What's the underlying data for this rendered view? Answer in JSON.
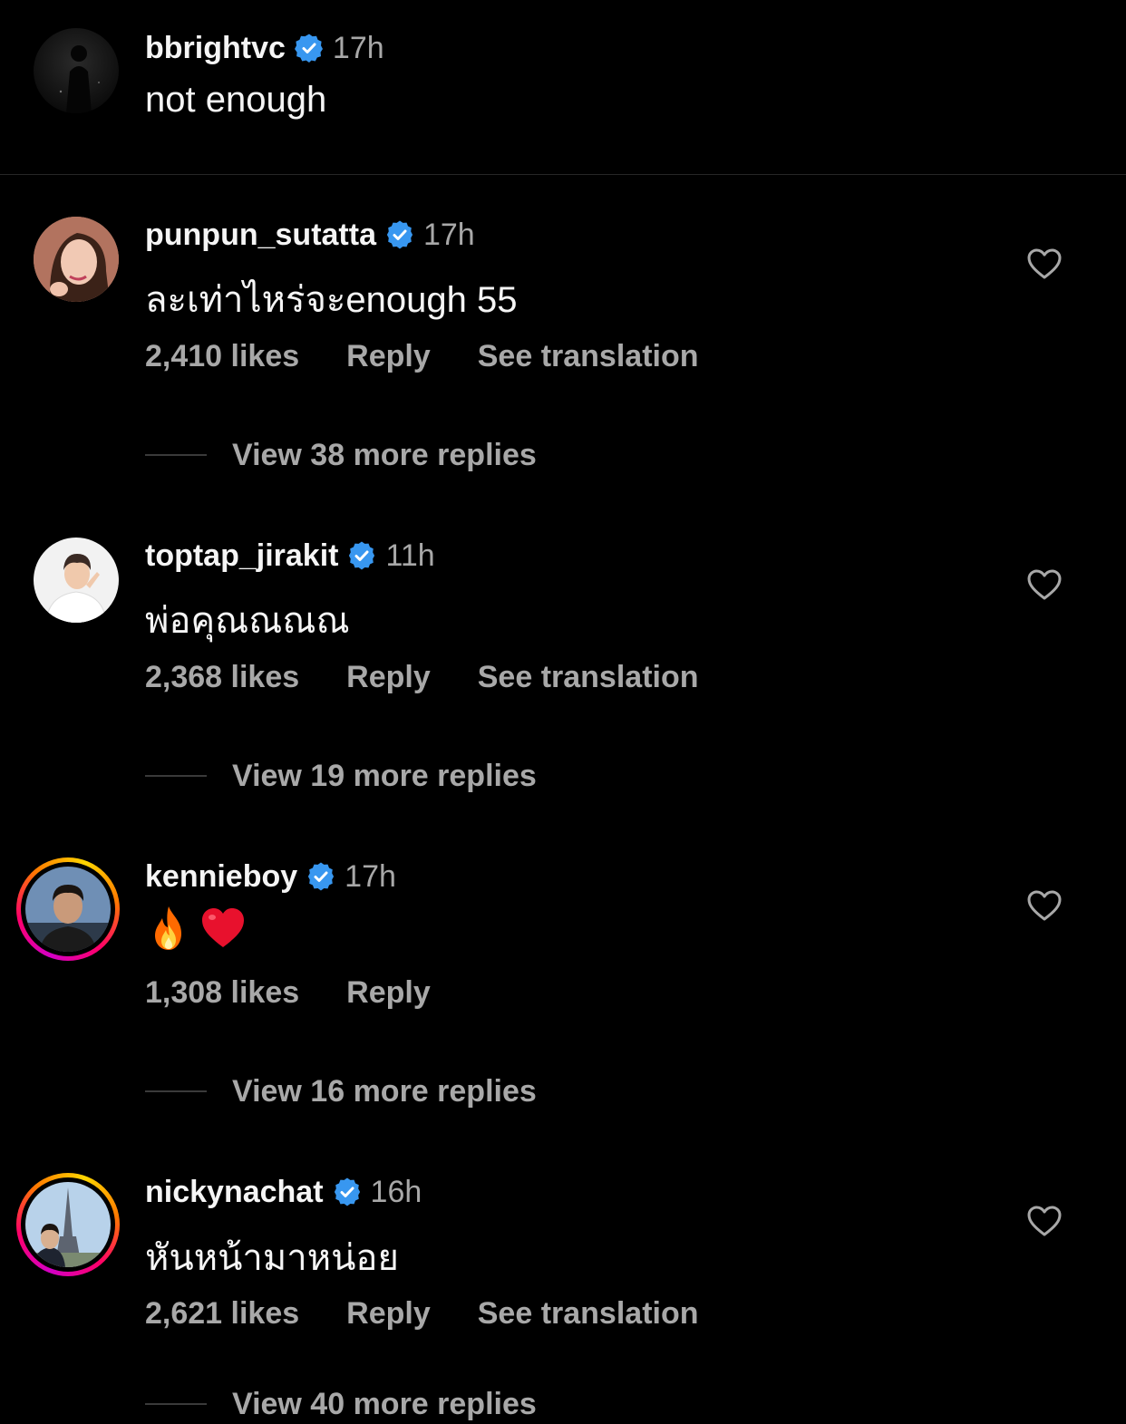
{
  "caption": {
    "username": "bbrightvc",
    "time": "17h",
    "text": "not enough"
  },
  "colors": {
    "verified": "#3897f0",
    "muted": "#a8a8a8",
    "primary": "#f5f5f5"
  },
  "comments": [
    {
      "username": "punpun_sutatta",
      "time": "17h",
      "text": "ละเท่าไหร่จะenough 55",
      "likes": "2,410 likes",
      "reply": "Reply",
      "translate": "See translation",
      "view_replies": "View 38 more replies"
    },
    {
      "username": "toptap_jirakit",
      "time": "11h",
      "text": "พ่อคุณณณณ",
      "likes": "2,368 likes",
      "reply": "Reply",
      "translate": "See translation",
      "view_replies": "View 19 more replies"
    },
    {
      "username": "kennieboy",
      "time": "17h",
      "emojis": [
        "fire-emoji",
        "red-heart-emoji"
      ],
      "likes": "1,308 likes",
      "reply": "Reply",
      "view_replies": "View 16 more replies"
    },
    {
      "username": "nickynachat",
      "time": "16h",
      "text": "หันหน้ามาหน่อย",
      "likes": "2,621 likes",
      "reply": "Reply",
      "translate": "See translation",
      "view_replies": "View 40 more replies"
    }
  ]
}
